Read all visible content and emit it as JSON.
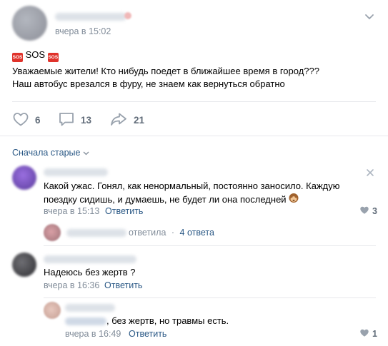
{
  "post": {
    "time": "вчера в 15:02",
    "tag_label": "SOS",
    "sos_icon_text": "SOS",
    "line1": "Уважаемые жители! Кто нибудь поедет в ближайшее время в город???",
    "line2": "Наш автобус врезался в фуру, не знаем как вернуться обратно",
    "likes": "6",
    "comments": "13",
    "shares": "21"
  },
  "comments_header": {
    "sort_label": "Сначала старые"
  },
  "comment1": {
    "text_line1": "Какой ужас. Гонял, как ненормальный, постоянно заносило. Каждую",
    "text_line2": "поездку сидишь, и думаешь, не будет ли она последней",
    "time": "вчера в 15:13",
    "reply_label": "Ответить",
    "likes": "3",
    "thread_action": "ответила",
    "thread_sep": "·",
    "thread_count": "4 ответа"
  },
  "comment2": {
    "text": "Надеюсь без жертв ?",
    "time": "вчера в 16:36",
    "reply_label": "Ответить"
  },
  "reply1": {
    "text": ", без жертв, но травмы есть.",
    "time": "вчера в 16:49",
    "reply_label": "Ответить",
    "likes": "1"
  },
  "colors": {
    "accent": "#2a5885",
    "meta": "#818c99",
    "icon": "#99a2ad",
    "sos": "#e0332b"
  }
}
